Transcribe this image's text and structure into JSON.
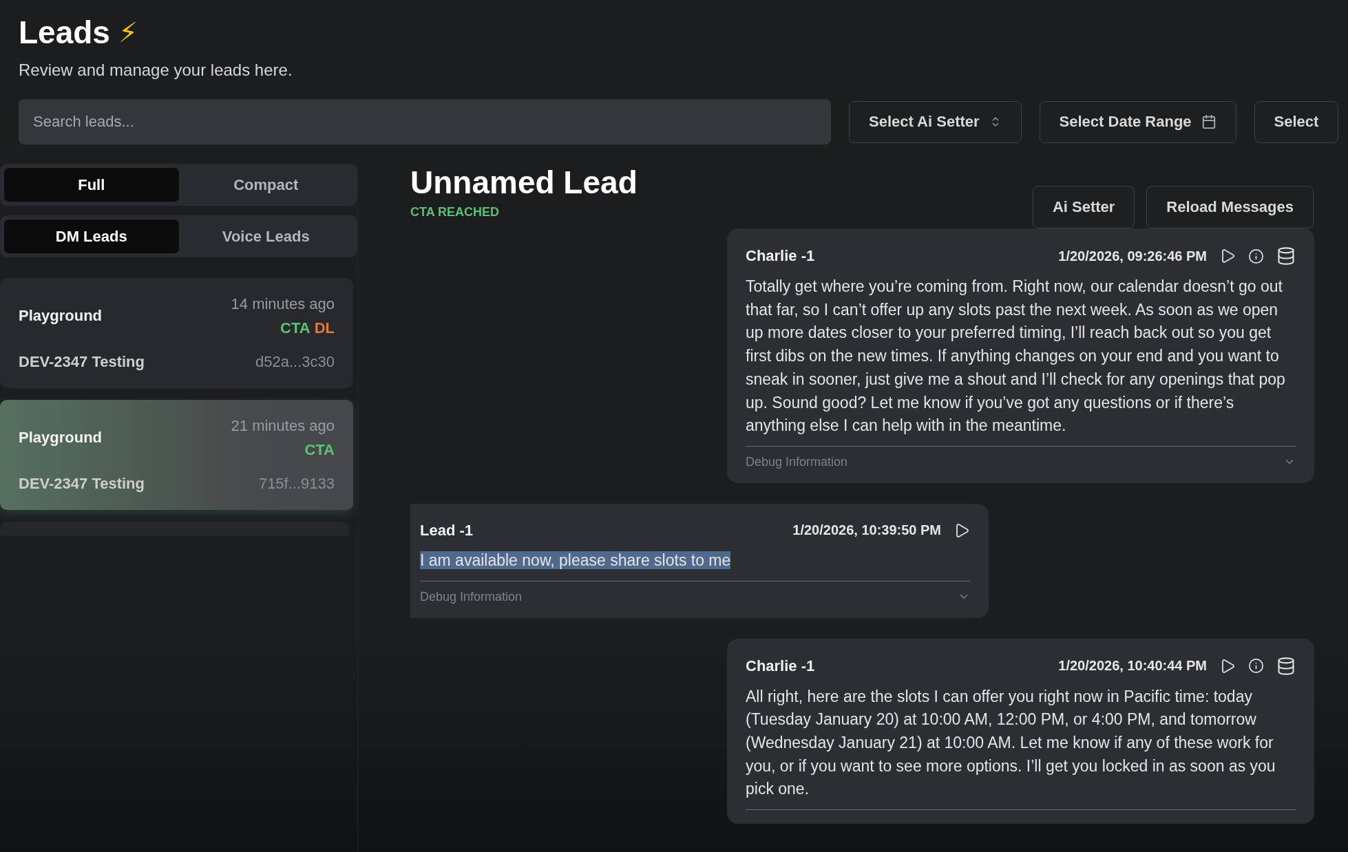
{
  "header": {
    "title": "Leads",
    "title_emoji": "⚡",
    "subtitle": "Review and manage your leads here."
  },
  "search": {
    "placeholder": "Search leads..."
  },
  "filters": [
    {
      "label": "Select Ai Setter",
      "kind": "select"
    },
    {
      "label": "Select Date Range",
      "kind": "date"
    },
    {
      "label": "Select",
      "kind": "plain"
    }
  ],
  "view_toggle": [
    {
      "label": "Full",
      "selected": true
    },
    {
      "label": "Compact",
      "selected": false
    }
  ],
  "lead_type_toggle": [
    {
      "label": "DM Leads",
      "selected": true
    },
    {
      "label": "Voice Leads",
      "selected": false
    }
  ],
  "leads": [
    {
      "name": "Playground",
      "time": "14 minutes ago",
      "tags": [
        {
          "label": "CTA",
          "color": "#5bc274"
        },
        {
          "label": "DL",
          "color": "#e07c3a"
        }
      ],
      "project": "DEV-2347 Testing",
      "id": "d52a...3c30",
      "selected": false
    },
    {
      "name": "Playground",
      "time": "21 minutes ago",
      "tags": [
        {
          "label": "CTA",
          "color": "#5bc274"
        }
      ],
      "project": "DEV-2347 Testing",
      "id": "715f...9133",
      "selected": true
    }
  ],
  "conversation": {
    "title": "Unnamed Lead",
    "status": "CTA REACHED",
    "actions": [
      "Ai Setter",
      "Reload Messages"
    ],
    "messages": [
      {
        "kind": "agent",
        "sender": "Charlie -1",
        "time": "1/20/2026, 09:26:46 PM",
        "text": "Totally get where you’re coming from. Right now, our calendar doesn’t go out that far, so I can’t offer up any slots past the next week. As soon as we open up more dates closer to your preferred timing, I’ll reach back out so you get first dibs on the new times. If anything changes on your end and you want to sneak in sooner, just give me a shout and I’ll check for any openings that pop up. Sound good? Let me know if you’ve got any questions or if there’s anything else I can help with in the meantime.",
        "text_selected": false,
        "debug_label": "Debug Information"
      },
      {
        "kind": "lead",
        "sender": "Lead -1",
        "time": "1/20/2026, 10:39:50 PM",
        "text": "I am available now, please share slots to me",
        "text_selected": true,
        "debug_label": "Debug Information"
      },
      {
        "kind": "agent",
        "sender": "Charlie -1",
        "time": "1/20/2026, 10:40:44 PM",
        "text": "All right, here are the slots I can offer you right now in Pacific time: today (Tuesday January 20) at 10:00 AM, 12:00 PM, or 4:00 PM, and tomorrow (Wednesday January 21) at 10:00 AM. Let me know if any of these work for you, or if you want to see more options. I’ll get you locked in as soon as you pick one.",
        "text_selected": false
      }
    ]
  }
}
